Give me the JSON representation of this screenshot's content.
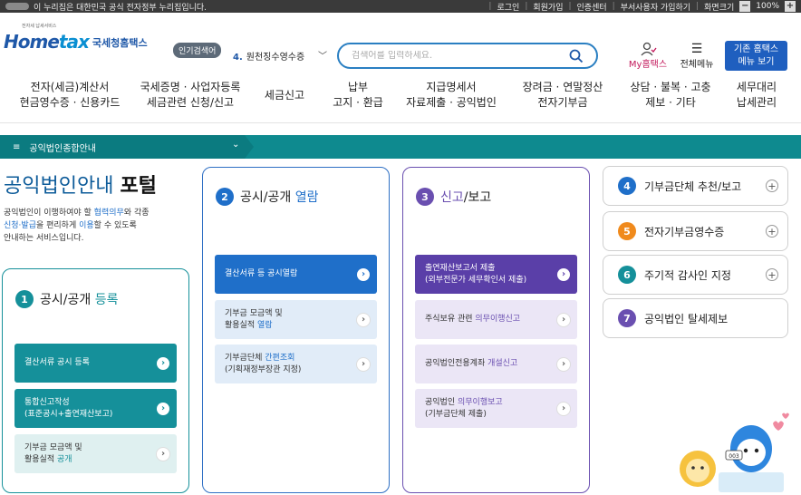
{
  "topbar": {
    "notice": "이 누리집은 대한민국 공식 전자정부 누리집입니다.",
    "links": [
      "로그인",
      "회원가입",
      "인증센터",
      "부서사용자 가입하기",
      "화면크기"
    ],
    "zoom_minus": "−",
    "zoom": "100%",
    "zoom_plus": "+"
  },
  "header": {
    "logo_sub": "전자세 납세서비스",
    "logo_home": "Home",
    "logo_tax": "tax",
    "logo_kor": "국세청홈택스",
    "popular_tag": "인기검색어",
    "popular_rank": "4.",
    "popular_keyword": "원천징수영수증",
    "search_placeholder": "검색어를 입력하세요.",
    "my_hometax": "My홈택스",
    "all_menu": "전체메뉴",
    "basic_menu_line1": "기존 홈택스",
    "basic_menu_line2": "메뉴 보기"
  },
  "gnb": [
    {
      "line1": "전자(세금)계산서",
      "line2": "현금영수증 · 신용카드"
    },
    {
      "line1": "국세증명 · 사업자등록",
      "line2": "세금관련 신청/신고"
    },
    {
      "line1": "세금신고",
      "line2": ""
    },
    {
      "line1": "납부",
      "line2": "고지 · 환급"
    },
    {
      "line1": "지급명세서",
      "line2": "자료제출 · 공익법인"
    },
    {
      "line1": "장려금 · 연말정산",
      "line2": "전자기부금"
    },
    {
      "line1": "상담 · 불복 · 고충",
      "line2": "제보 · 기타"
    },
    {
      "line1": "세무대리",
      "line2": "납세관리"
    }
  ],
  "breadcrumb": {
    "label": "공익법인종합안내"
  },
  "portal": {
    "title_a": "공익법인안내 ",
    "title_b": "포털",
    "intro_1": "공익법인이 이행하여야 할 ",
    "intro_hl1": "협력의무",
    "intro_2": "와 각종",
    "intro_hl2": "신청·발급",
    "intro_3": "을 편리하게 ",
    "intro_hl3": "이용",
    "intro_4": "할 수 있도록",
    "intro_5": "안내하는 서비스입니다."
  },
  "card1": {
    "num": "1",
    "title": "공시/공개 ",
    "title_hl": "등록",
    "buttons": [
      {
        "l1": "결산서류 공시 등록",
        "l2": ""
      },
      {
        "l1": "통합신고작성",
        "l2": "(표준공시+출연재산보고)"
      },
      {
        "l1": "기부금 모금액 및",
        "l2a": "활용실적 ",
        "l2hl": "공개"
      }
    ]
  },
  "card2": {
    "num": "2",
    "title": "공시/공개 ",
    "title_hl": "열람",
    "buttons": [
      {
        "l1": "결산서류 등 공시열람"
      },
      {
        "l1": "기부금 모금액 및",
        "l2a": "활용실적 ",
        "l2hl": "열람"
      },
      {
        "l1a": "기부금단체 ",
        "l1hl": "간편조회",
        "l2": "(기획재정부장관 지정)"
      }
    ]
  },
  "card3": {
    "num": "3",
    "title_hl": "신고",
    "title": "/보고",
    "buttons": [
      {
        "l1": "출연재산보고서 제출",
        "l2": "(외부전문가 세무확인서 제출)"
      },
      {
        "l1a": "주식보유 관련 ",
        "l1hl": "의무이행신고"
      },
      {
        "l1a": "공익법인전용계좌 ",
        "l1hl": "개설신고"
      },
      {
        "l1a": "공익법인 ",
        "l1hl": "의무이행보고",
        "l2": "(기부금단체 제출)"
      }
    ]
  },
  "side": [
    {
      "num": "4",
      "label": "기부금단체 추천/보고",
      "color": "#1f6fc9",
      "plus": "+"
    },
    {
      "num": "5",
      "label": "전자기부금영수증",
      "color": "#f08a1c",
      "plus": "+"
    },
    {
      "num": "6",
      "label": "주기적 감사인 지정",
      "color": "#15909a",
      "plus": "+"
    },
    {
      "num": "7",
      "label": "공익법인 탈세제보",
      "color": "#6a4fb0",
      "plus": ""
    }
  ],
  "mascot": {
    "badge": "003"
  },
  "colors": {
    "teal": "#15909a",
    "blue": "#1f6fc9",
    "purple": "#5a3fa8"
  }
}
